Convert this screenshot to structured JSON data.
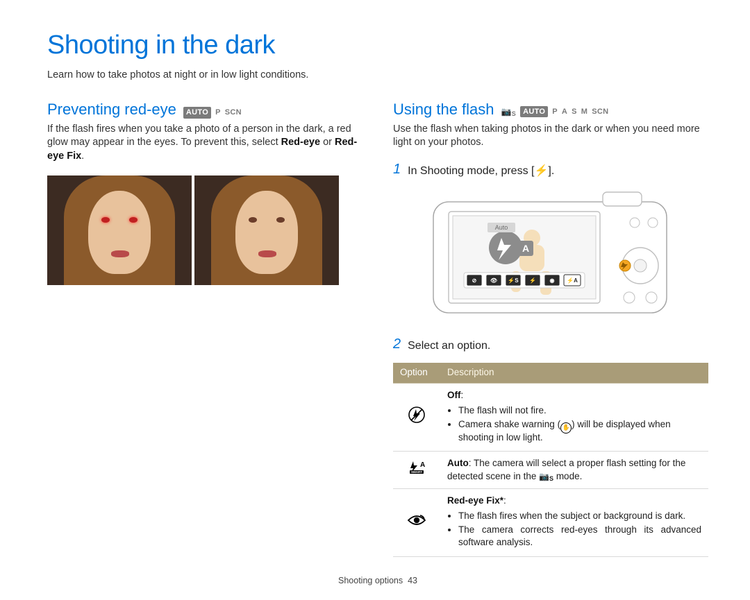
{
  "title": "Shooting in the dark",
  "intro": "Learn how to take photos at night or in low light conditions.",
  "left": {
    "heading": "Preventing red-eye",
    "modes": {
      "auto": "AUTO",
      "p": "P",
      "scn": "SCN"
    },
    "para_pre": "If the flash fires when you take a photo of a person in the dark, a red glow may appear in the eyes. To prevent this, select ",
    "bold1": "Red-eye",
    "mid": " or ",
    "bold2": "Red-eye Fix",
    "post": "."
  },
  "right": {
    "heading": "Using the flash",
    "modes": {
      "cs": "S",
      "auto": "AUTO",
      "p": "P",
      "a": "A",
      "s": "S",
      "m": "M",
      "scn": "SCN"
    },
    "para": "Use the flash when taking photos in the dark or when you need more light on your photos.",
    "step1_num": "1",
    "step1_pre": "In Shooting mode, press [",
    "step1_icon": "⚡",
    "step1_post": "].",
    "screen_label": "Auto",
    "step2_num": "2",
    "step2_text": "Select an option.",
    "table": {
      "col1": "Option",
      "col2": "Description",
      "rows": [
        {
          "icon_label": "off-flash-icon",
          "title": "Off",
          "bullets": [
            "The flash will not fire.",
            "Camera shake warning ( ✋ ) will be displayed when shooting in low light."
          ]
        },
        {
          "icon_label": "smart-auto-flash-icon",
          "title": "Auto",
          "desc_pre": ": The camera will select a proper flash setting for the detected scene in the ",
          "desc_mode": "S",
          "desc_post": " mode."
        },
        {
          "icon_label": "red-eye-fix-icon",
          "title": "Red-eye Fix*",
          "bullets_just": [
            "The flash fires when the subject or background is dark.",
            "The camera corrects red-eyes through its advanced software analysis."
          ]
        }
      ]
    }
  },
  "footer": {
    "label": "Shooting options",
    "page": "43"
  }
}
